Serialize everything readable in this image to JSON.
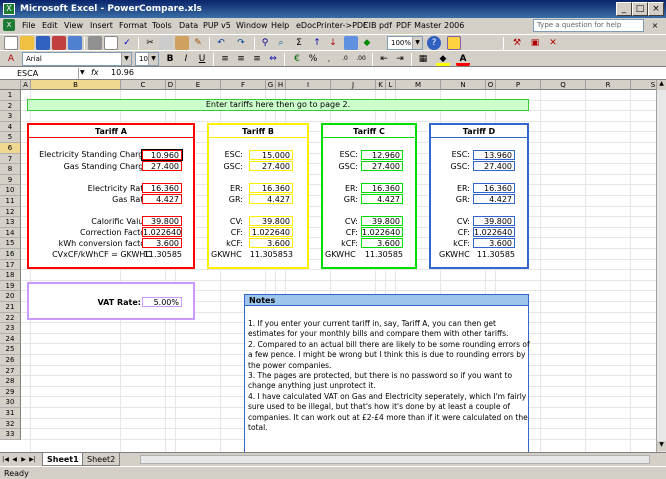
{
  "window": {
    "title": "Microsoft Excel - PowerCompare.xls"
  },
  "menu": [
    "File",
    "Edit",
    "View",
    "Insert",
    "Format",
    "Tools",
    "Data",
    "PUP v5",
    "Window",
    "Help",
    "eDocPrinter->PDF",
    "CIB pdf",
    "PDF Master 2006"
  ],
  "help_placeholder": "Type a question for help",
  "toolbar": {
    "zoom": "100%",
    "font": "Arial",
    "size": "10"
  },
  "formula": {
    "name_box": "ESCA",
    "fx": "fx",
    "value": "10.96"
  },
  "columns": [
    "A",
    "B",
    "C",
    "D",
    "E",
    "F",
    "G",
    "H",
    "I",
    "J",
    "K",
    "L",
    "M",
    "N",
    "O",
    "P",
    "Q",
    "R",
    "S"
  ],
  "rows": [
    "1",
    "2",
    "3",
    "4",
    "5",
    "6",
    "7",
    "8",
    "9",
    "10",
    "11",
    "12",
    "13",
    "14",
    "15",
    "16",
    "17",
    "18",
    "19",
    "20",
    "21",
    "22",
    "23",
    "24",
    "25",
    "26",
    "27",
    "28",
    "29",
    "30",
    "31",
    "32",
    "33"
  ],
  "banner": "Enter tariffs here then go to page 2.",
  "tariff_a": {
    "title": "Tariff A",
    "labels": {
      "esc": "Electricity Standing Charge:",
      "gsc": "Gas Standing Charge:",
      "er": "Electricity Rate:",
      "gr": "Gas Rate:",
      "cv": "Calorific Value:",
      "cf": "Correction Factor:",
      "kcf": "kWh conversion factor:",
      "gkwhc": "CVxCF/kWhCF = GKWHC"
    },
    "values": {
      "esc": "10.960",
      "gsc": "27.400",
      "er": "16.360",
      "gr": "4.427",
      "cv": "39.800",
      "cf": "1.022640",
      "kcf": "3.600",
      "gkwhc": "11.30585"
    },
    "color": "#ff0000"
  },
  "tariff_b": {
    "title": "Tariff B",
    "labels": {
      "esc": "ESC:",
      "gsc": "GSC:",
      "er": "ER:",
      "gr": "GR:",
      "cv": "CV:",
      "cf": "CF:",
      "kcf": "kCF:",
      "gkwhc": "GKWHC"
    },
    "values": {
      "esc": "15.000",
      "gsc": "27.400",
      "er": "16.360",
      "gr": "4.427",
      "cv": "39.800",
      "cf": "1.022640",
      "kcf": "3.600",
      "gkwhc": "11.305853"
    },
    "color": "#ffee00"
  },
  "tariff_c": {
    "title": "Tariff C",
    "labels": {
      "esc": "ESC:",
      "gsc": "GSC:",
      "er": "ER:",
      "gr": "GR:",
      "cv": "CV:",
      "cf": "CF:",
      "kcf": "kCF:",
      "gkwhc": "GKWHC"
    },
    "values": {
      "esc": "12.960",
      "gsc": "27.400",
      "er": "16.360",
      "gr": "4.427",
      "cv": "39.800",
      "cf": "1.022640",
      "kcf": "3.600",
      "gkwhc": "11.30585"
    },
    "color": "#00dd00"
  },
  "tariff_d": {
    "title": "Tariff D",
    "labels": {
      "esc": "ESC:",
      "gsc": "GSC:",
      "er": "ER:",
      "gr": "GR:",
      "cv": "CV:",
      "cf": "CF:",
      "kcf": "kCF:",
      "gkwhc": "GKWHC"
    },
    "values": {
      "esc": "13.960",
      "gsc": "27.400",
      "er": "16.360",
      "gr": "4.427",
      "cv": "39.800",
      "cf": "1.022640",
      "kcf": "3.600",
      "gkwhc": "11.30585"
    },
    "color": "#3366cc"
  },
  "vat": {
    "label": "VAT Rate:",
    "value": "5.00%",
    "color": "#cc99ff"
  },
  "notes": {
    "title": "Notes",
    "lines": [
      "1. If you enter your current tariff in, say, Tariff A, you can then get",
      "estimates for your monthly bills and compare them with other tariffs.",
      "2. Compared to an actual bill there are likely to be some rounding errors of",
      "a few pence. I might be wrong but I think this is due to rounding errors by",
      "the power companies.",
      "3. The pages are protected, but there is no password so if you want to",
      "change anything just unprotect it.",
      "4. I have calculated VAT on Gas and Electricity seperately, which I'm fairly",
      "sure used to be illegal, but that's how it's done by at least a couple of",
      "companies. It can work out at £2-£4 more than if it were calculated on the",
      "total."
    ]
  },
  "sheets": [
    "Sheet1",
    "Sheet2"
  ],
  "status": "Ready"
}
